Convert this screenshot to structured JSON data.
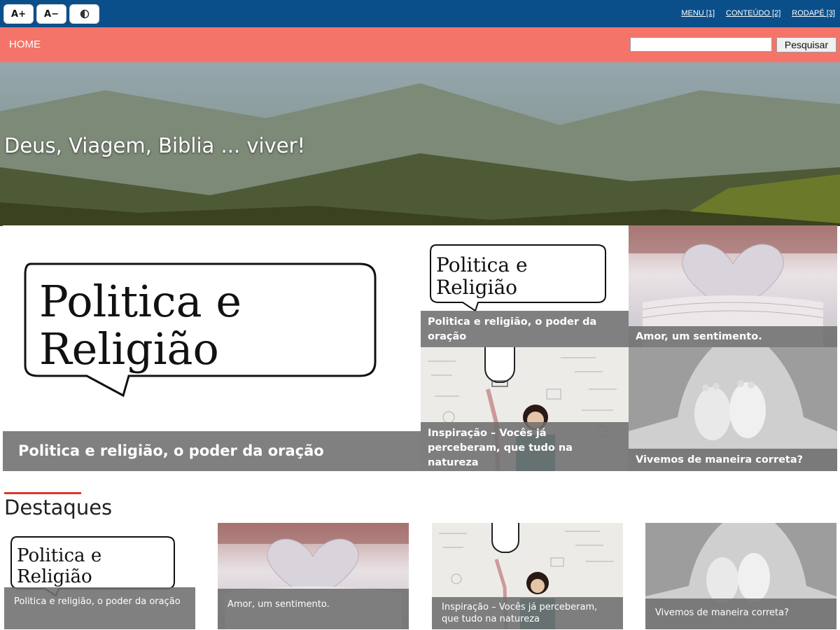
{
  "accessibility": {
    "increase_font": "A+",
    "decrease_font": "A−",
    "contrast_icon": "contrast-icon",
    "links": [
      "MENU [1]",
      "CONTEÚDO [2]",
      "RODAPÉ [3]"
    ]
  },
  "nav": {
    "home": "HOME",
    "search_placeholder": "",
    "search_button": "Pesquisar"
  },
  "hero": {
    "title": "Deus, Viagem, Biblia ... viver!"
  },
  "featured": {
    "main": {
      "image_text_line1": "Politica e",
      "image_text_line2": "Religião",
      "caption": "Politica e religião, o poder da oração"
    },
    "tiles": [
      {
        "image_text_line1": "Politica e",
        "image_text_line2": "Religião",
        "caption": "Politica e religião, o poder da oração"
      },
      {
        "caption": "Amor, um sentimento."
      },
      {
        "caption": "Inspiração – Vocês já perceberam, que tudo na natureza"
      },
      {
        "caption": "Vivemos de maneira correta?"
      }
    ]
  },
  "highlights": {
    "title": "Destaques",
    "cards": [
      {
        "image_text_line1": "Politica e",
        "image_text_line2": "Religião",
        "caption": "Politica e religião, o poder da oração"
      },
      {
        "caption": "Amor, um sentimento."
      },
      {
        "caption": "Inspiração – Vocês já perceberam, que tudo na natureza"
      },
      {
        "caption": "Vivemos de maneira correta?"
      }
    ]
  },
  "colors": {
    "top_bar": "#0b4f8a",
    "nav_bar": "#f47469",
    "accent_line": "#d83a2f"
  }
}
